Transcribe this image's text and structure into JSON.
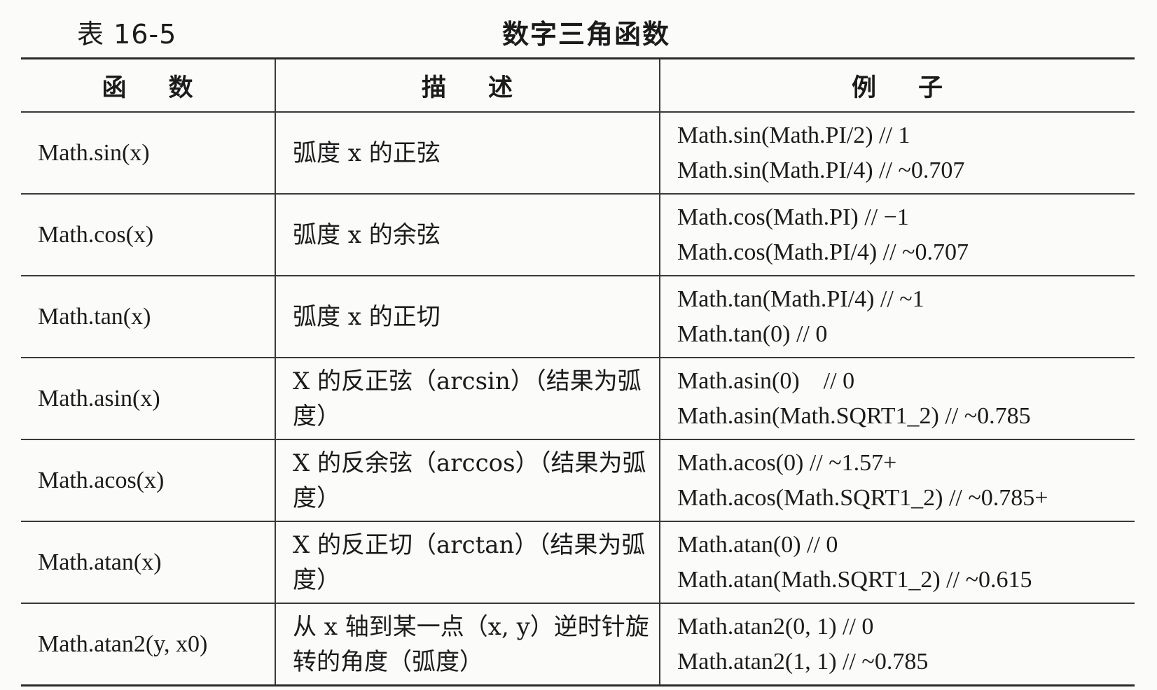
{
  "caption": {
    "label": "表 16-5",
    "title": "数字三角函数"
  },
  "table": {
    "headers": [
      "函数",
      "描述",
      "例子"
    ],
    "rows": [
      {
        "function": "Math.sin(x)",
        "description": "弧度 x 的正弦",
        "examples": [
          "Math.sin(Math.PI/2) // 1",
          "Math.sin(Math.PI/4) // ~0.707"
        ]
      },
      {
        "function": "Math.cos(x)",
        "description": "弧度 x 的余弦",
        "examples": [
          "Math.cos(Math.PI) // −1",
          "Math.cos(Math.PI/4) // ~0.707"
        ]
      },
      {
        "function": "Math.tan(x)",
        "description": "弧度 x 的正切",
        "examples": [
          "Math.tan(Math.PI/4) // ~1",
          "Math.tan(0) // 0"
        ]
      },
      {
        "function": "Math.asin(x)",
        "description": "X 的反正弦（arcsin）（结果为弧度）",
        "examples": [
          "Math.asin(0)    // 0",
          "Math.asin(Math.SQRT1_2) // ~0.785"
        ]
      },
      {
        "function": "Math.acos(x)",
        "description": "X 的反余弦（arccos）（结果为弧度）",
        "examples": [
          "Math.acos(0) // ~1.57+",
          "Math.acos(Math.SQRT1_2) // ~0.785+"
        ]
      },
      {
        "function": "Math.atan(x)",
        "description": "X 的反正切（arctan）（结果为弧度）",
        "examples": [
          "Math.atan(0) // 0",
          "Math.atan(Math.SQRT1_2) // ~0.615"
        ]
      },
      {
        "function": "Math.atan2(y, x0)",
        "description": "从 x 轴到某一点（x, y）逆时针旋转的角度（弧度）",
        "examples": [
          "Math.atan2(0, 1) // 0",
          "Math.atan2(1, 1) // ~0.785"
        ]
      }
    ]
  }
}
